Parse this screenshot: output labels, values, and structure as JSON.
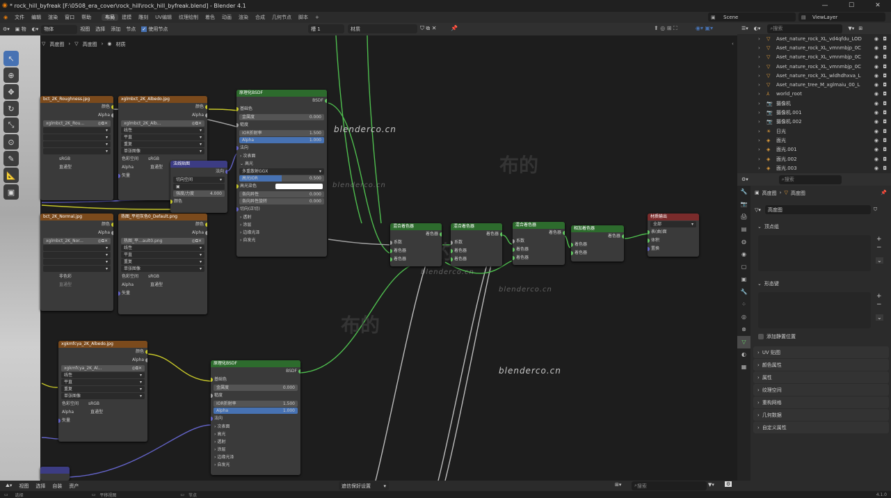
{
  "window": {
    "title": "* rock_hill_byfreak [F:\\0508_era_cover\\rock_hill\\rock_hill_byfreak.blend] - Blender 4.1"
  },
  "menus": [
    "文件",
    "编辑",
    "渲染",
    "窗口",
    "帮助"
  ],
  "workspaces": [
    "布局",
    "建模",
    "雕刻",
    "UV编辑",
    "纹理绘制",
    "着色",
    "动画",
    "渲染",
    "合成",
    "几何节点",
    "脚本",
    "+"
  ],
  "scene": {
    "name": "Scene",
    "view_layer": "ViewLayer"
  },
  "editor_header": {
    "object_label": "物体",
    "view": "视图",
    "select": "选择",
    "add": "添加",
    "node": "节点",
    "use_nodes": "使用节点",
    "slot": "槽 1",
    "material": "材质"
  },
  "breadcrumb": [
    "高度图",
    "高度图",
    "材质"
  ],
  "watermark_text": "blenderco.cn",
  "watermark_cn": "布的",
  "nodes": {
    "roughness_tex": {
      "title": "bct_2K_Roughness.jpg",
      "image": "xglmbct_2K_Rou...",
      "out_color": "颜色",
      "out_alpha": "Alpha",
      "interp": "线性",
      "proj": "平直",
      "ext": "重复",
      "src": "单张图像",
      "cs_label": "色彩空间",
      "cs_value": "sRGB",
      "alpha_label": "Alpha",
      "alpha_value": "直通型",
      "vector": "矢量"
    },
    "albedo_tex": {
      "title": "xglmbct_2K_Albedo.jpg",
      "image": "xglmbct_2K_Alb...",
      "out_color": "颜色",
      "out_alpha": "Alpha",
      "interp": "线性",
      "proj": "平直",
      "ext": "重复",
      "src": "单张图像",
      "cs_label": "色彩空间",
      "cs_value": "sRGB",
      "alpha_label": "Alpha",
      "alpha_value": "直通型",
      "vector": "矢量"
    },
    "normal_map": {
      "title": "法线贴图",
      "out": "法向",
      "space": "切向空间",
      "strength_label": "强度/力度",
      "strength_value": "4.000",
      "color": "颜色"
    },
    "normal_tex": {
      "title": "bct_2K_Normal.jpg",
      "image": "xglmbct_2K_Nor...",
      "out_color": "颜色",
      "out_alpha": "Alpha",
      "cs_value": "非色彩",
      "alpha_value": "直通型"
    },
    "detail_tex": {
      "title": "热图_平坦灰色0_Default.png",
      "image": "热图_平...ault0.png",
      "out_color": "颜色",
      "out_alpha": "Alpha",
      "interp": "线性",
      "proj": "平直",
      "ext": "重复",
      "src": "单张图像",
      "cs_label": "色彩空间",
      "cs_value": "sRGB",
      "alpha_label": "Alpha",
      "alpha_value": "直通型",
      "vector": "矢量"
    },
    "bsdf1": {
      "title": "原理化BSDF",
      "out": "BSDF",
      "base_color": "基础色",
      "metallic_label": "金属度",
      "metallic_value": "0.000",
      "roughness": "糙度",
      "ior_label": "IOR折射率",
      "ior_value": "1.500",
      "alpha_label": "Alpha",
      "alpha_value": "1.000",
      "normal": "法向",
      "subsurface": "次表面",
      "specular": "高光",
      "distribution": "多重散射GGX",
      "spec_ior_label": "高光IOR",
      "spec_ior_value": "0.500",
      "spec_tint": "高光染色",
      "aniso_label": "各向异性",
      "aniso_value": "0.000",
      "aniso_rot_label": "各向异性旋转",
      "aniso_rot_value": "0.000",
      "tangent": "切向(正切)",
      "transmission": "透射",
      "coat": "涂层",
      "sheen": "边缘光泽",
      "emission": "自发光"
    },
    "mix1": {
      "title": "混合着色器",
      "out": "着色器",
      "fac": "系数",
      "in1": "着色器",
      "in2": "着色器"
    },
    "mix2": {
      "title": "混合着色器",
      "out": "着色器",
      "fac": "系数",
      "in1": "着色器",
      "in2": "着色器"
    },
    "mix3": {
      "title": "混合着色器",
      "out": "着色器",
      "fac": "系数",
      "in1": "着色器",
      "in2": "着色器"
    },
    "add": {
      "title": "相加着色器",
      "out": "着色器",
      "in1": "着色器",
      "in2": "着色器"
    },
    "output": {
      "title": "材质输出",
      "target": "全部",
      "surface": "表(曲)面",
      "volume": "体积",
      "disp": "置换"
    },
    "albedo2_tex": {
      "title": "xgkmfcya_2K_Albedo.jpg",
      "image": "xgkmfcya_2K_Al...",
      "out_color": "颜色",
      "out_alpha": "Alpha",
      "interp": "线性",
      "proj": "平直",
      "ext": "重复",
      "src": "单张图像",
      "cs_label": "色彩空间",
      "cs_value": "sRGB",
      "alpha_label": "Alpha",
      "alpha_value": "直通型",
      "vector": "矢量"
    },
    "bsdf2": {
      "title": "原理化BSDF",
      "out": "BSDF",
      "base_color": "基础色",
      "metallic_label": "金属度",
      "metallic_value": "0.000",
      "roughness": "糙度",
      "ior_label": "IOR折射率",
      "ior_value": "1.500",
      "alpha_label": "Alpha",
      "alpha_value": "1.000",
      "normal": "法向",
      "subsurface": "次表面",
      "specular": "高光",
      "transmission": "透射",
      "coat": "涂层",
      "sheen": "边缘光泽",
      "emission": "自发光"
    }
  },
  "outliner": {
    "search_placeholder": "搜索",
    "items": [
      {
        "label": "Aset_nature_rock_XL_vd4qfdu_LOD"
      },
      {
        "label": "Aset_nature_rock_XL_vmnmbjp_0C"
      },
      {
        "label": "Aset_nature_rock_XL_vmnmbjp_0C"
      },
      {
        "label": "Aset_nature_rock_XL_vmnmbjp_0C"
      },
      {
        "label": "Aset_nature_rock_XL_wldhdhxva_L"
      },
      {
        "label": "Aset_nature_tree_M_xglmaiu_00_L"
      },
      {
        "label": "world_root"
      },
      {
        "label": "摄像机"
      },
      {
        "label": "摄像机.001"
      },
      {
        "label": "摄像机.002"
      },
      {
        "label": "日光"
      },
      {
        "label": "面光"
      },
      {
        "label": "面光.001"
      },
      {
        "label": "面光.002"
      },
      {
        "label": "面光.003"
      }
    ]
  },
  "properties": {
    "search_placeholder": "搜索",
    "crumb_obj": "高度图",
    "crumb_mesh": "高度图",
    "mesh_name": "高度图",
    "vertex_groups": "顶点组",
    "shape_keys": "形态键",
    "relative": "添加静置位置",
    "panels": [
      "UV 贴图",
      "颜色属性",
      "属性",
      "纹理空间",
      "重构网格",
      "几何数据",
      "自定义属性"
    ]
  },
  "footer": {
    "view": "视图",
    "select": "选择",
    "add": "自装",
    "assets": "资产",
    "library": "遮信保好设置",
    "search_placeholder": "搜索"
  },
  "status": {
    "select": "选择",
    "pan": "平移视图",
    "node": "节点",
    "version": "4.1.0"
  }
}
